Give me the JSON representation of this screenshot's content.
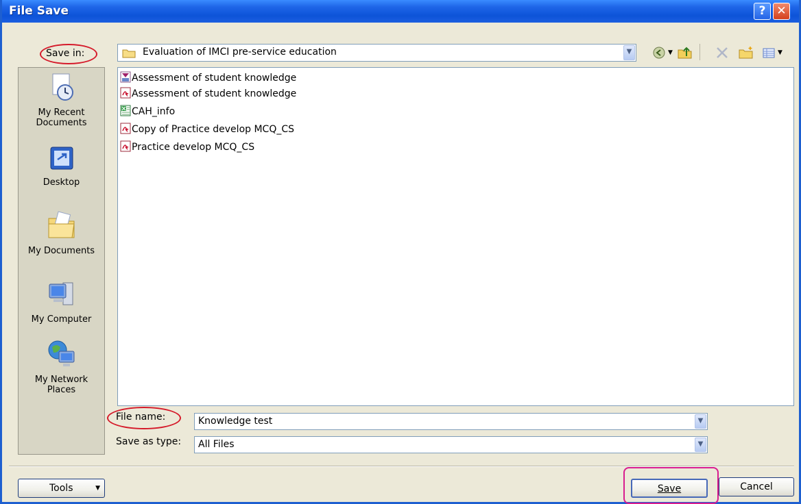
{
  "window": {
    "title": "File Save"
  },
  "save_in": {
    "label": "Save in:",
    "folder": "Evaluation of IMCI pre-service education"
  },
  "places": [
    {
      "label": "My Recent Documents",
      "icon": "recent-documents-icon"
    },
    {
      "label": "Desktop",
      "icon": "desktop-icon"
    },
    {
      "label": "My Documents",
      "icon": "my-documents-icon"
    },
    {
      "label": "My Computer",
      "icon": "my-computer-icon"
    },
    {
      "label": "My Network Places",
      "icon": "network-places-icon"
    }
  ],
  "files": [
    {
      "name": "Assessment of student knowledge",
      "icon": "access-file-icon"
    },
    {
      "name": "Assessment of student knowledge",
      "icon": "pdf-file-icon"
    },
    {
      "name": "CAH_info",
      "icon": "excel-file-icon"
    },
    {
      "name": "Copy of Practice develop MCQ_CS",
      "icon": "pdf-file-icon"
    },
    {
      "name": "Practice develop MCQ_CS",
      "icon": "pdf-file-icon"
    }
  ],
  "file_name": {
    "label": "File name:",
    "value": "Knowledge test"
  },
  "save_as_type": {
    "label": "Save as type:",
    "value": "All Files"
  },
  "buttons": {
    "tools": "Tools",
    "save": "Save",
    "cancel": "Cancel"
  },
  "colors": {
    "title_bar": "#0d53d8",
    "annotation_red": "#d51a2a",
    "annotation_pink": "#d81c8e"
  }
}
